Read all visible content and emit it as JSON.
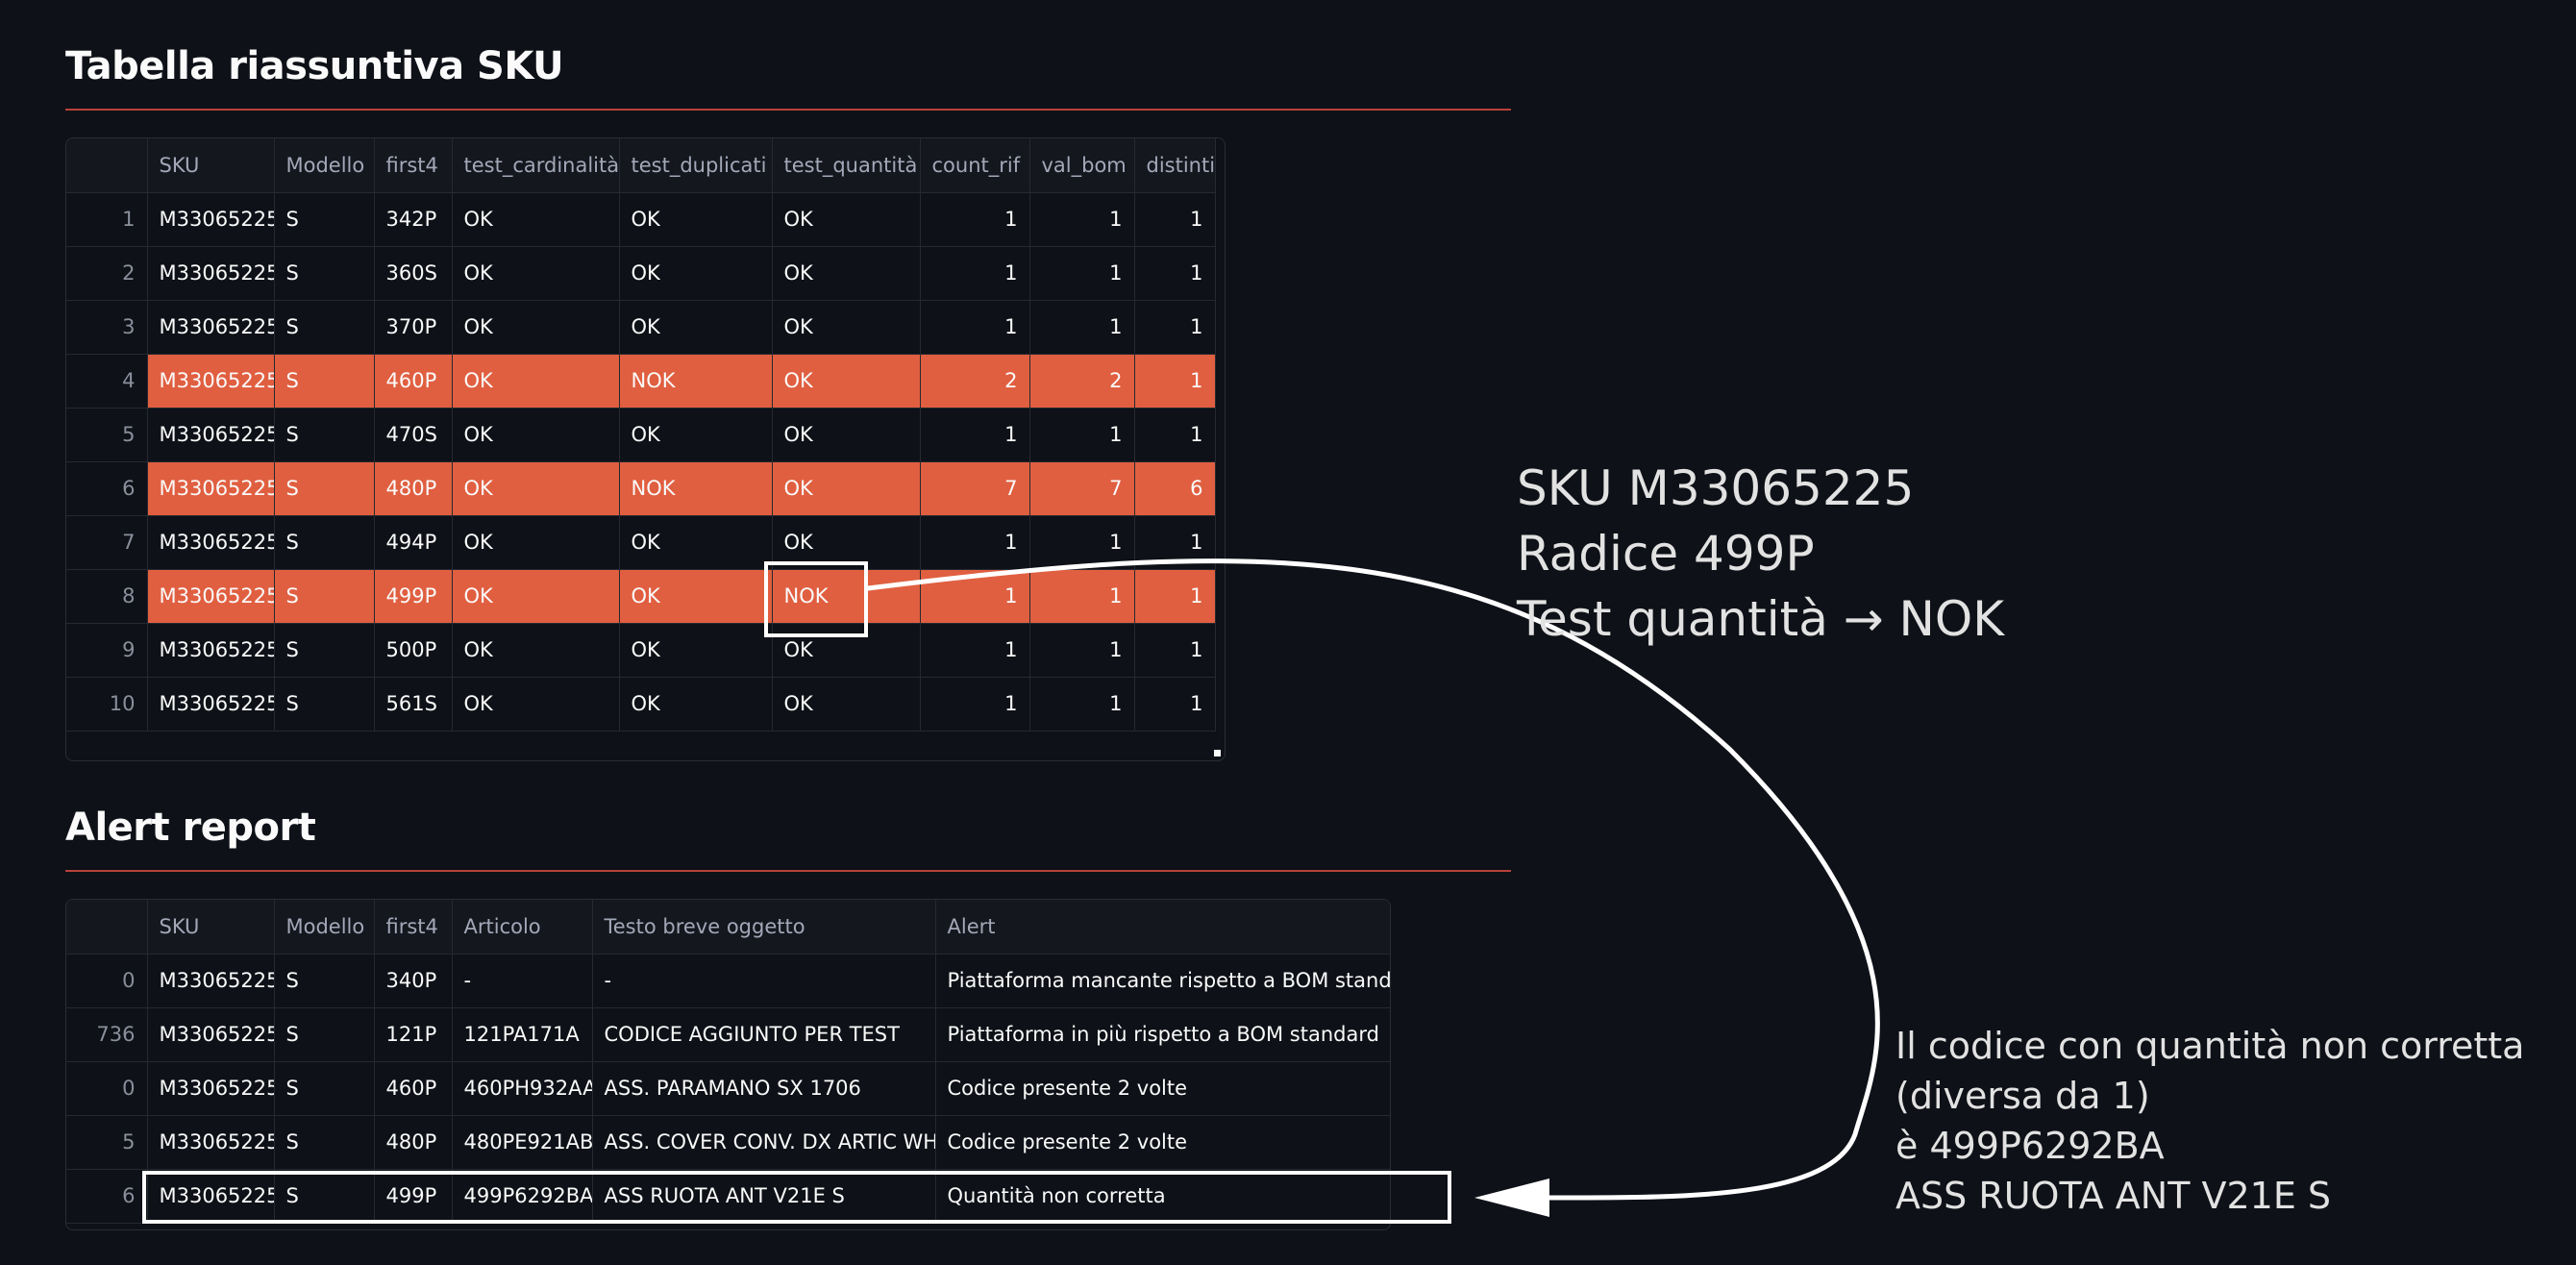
{
  "summary": {
    "title": "Tabella riassuntiva SKU",
    "columns": [
      "",
      "SKU",
      "Modello",
      "first4",
      "test_cardinalità",
      "test_duplicati",
      "test_quantità",
      "count_rif",
      "val_bom",
      "distinti"
    ],
    "rows": [
      {
        "index": "1",
        "sku": "M33065225",
        "modello": "S",
        "first4": "342P",
        "card": "OK",
        "dup": "OK",
        "qty": "OK",
        "count_rif": "1",
        "val_bom": "1",
        "distinti": "1",
        "highlight": false
      },
      {
        "index": "2",
        "sku": "M33065225",
        "modello": "S",
        "first4": "360S",
        "card": "OK",
        "dup": "OK",
        "qty": "OK",
        "count_rif": "1",
        "val_bom": "1",
        "distinti": "1",
        "highlight": false
      },
      {
        "index": "3",
        "sku": "M33065225",
        "modello": "S",
        "first4": "370P",
        "card": "OK",
        "dup": "OK",
        "qty": "OK",
        "count_rif": "1",
        "val_bom": "1",
        "distinti": "1",
        "highlight": false
      },
      {
        "index": "4",
        "sku": "M33065225",
        "modello": "S",
        "first4": "460P",
        "card": "OK",
        "dup": "NOK",
        "qty": "OK",
        "count_rif": "2",
        "val_bom": "2",
        "distinti": "1",
        "highlight": true
      },
      {
        "index": "5",
        "sku": "M33065225",
        "modello": "S",
        "first4": "470S",
        "card": "OK",
        "dup": "OK",
        "qty": "OK",
        "count_rif": "1",
        "val_bom": "1",
        "distinti": "1",
        "highlight": false
      },
      {
        "index": "6",
        "sku": "M33065225",
        "modello": "S",
        "first4": "480P",
        "card": "OK",
        "dup": "NOK",
        "qty": "OK",
        "count_rif": "7",
        "val_bom": "7",
        "distinti": "6",
        "highlight": true
      },
      {
        "index": "7",
        "sku": "M33065225",
        "modello": "S",
        "first4": "494P",
        "card": "OK",
        "dup": "OK",
        "qty": "OK",
        "count_rif": "1",
        "val_bom": "1",
        "distinti": "1",
        "highlight": false
      },
      {
        "index": "8",
        "sku": "M33065225",
        "modello": "S",
        "first4": "499P",
        "card": "OK",
        "dup": "OK",
        "qty": "NOK",
        "count_rif": "1",
        "val_bom": "1",
        "distinti": "1",
        "highlight": true
      },
      {
        "index": "9",
        "sku": "M33065225",
        "modello": "S",
        "first4": "500P",
        "card": "OK",
        "dup": "OK",
        "qty": "OK",
        "count_rif": "1",
        "val_bom": "1",
        "distinti": "1",
        "highlight": false
      },
      {
        "index": "10",
        "sku": "M33065225",
        "modello": "S",
        "first4": "561S",
        "card": "OK",
        "dup": "OK",
        "qty": "OK",
        "count_rif": "1",
        "val_bom": "1",
        "distinti": "1",
        "highlight": false
      }
    ]
  },
  "alerts": {
    "title": "Alert report",
    "columns": [
      "",
      "SKU",
      "Modello",
      "first4",
      "Articolo",
      "Testo breve oggetto",
      "Alert"
    ],
    "rows": [
      {
        "index": "0",
        "sku": "M33065225",
        "modello": "S",
        "first4": "340P",
        "articolo": "-",
        "testo": "-",
        "alert": "Piattaforma mancante rispetto a BOM standard"
      },
      {
        "index": "736",
        "sku": "M33065225",
        "modello": "S",
        "first4": "121P",
        "articolo": "121PA171A",
        "testo": "CODICE AGGIUNTO PER TEST",
        "alert": "Piattaforma in più rispetto a BOM standard"
      },
      {
        "index": "0",
        "sku": "M33065225",
        "modello": "S",
        "first4": "460P",
        "articolo": "460PH932AA",
        "testo": "ASS. PARAMANO SX 1706",
        "alert": "Codice presente 2 volte"
      },
      {
        "index": "5",
        "sku": "M33065225",
        "modello": "S",
        "first4": "480P",
        "articolo": "480PE921AB",
        "testo": "ASS. COVER CONV. DX ARTIC WHITE",
        "alert": "Codice presente 2 volte"
      },
      {
        "index": "6",
        "sku": "M33065225",
        "modello": "S",
        "first4": "499P",
        "articolo": "499P6292BA",
        "testo": "ASS RUOTA ANT V21E S",
        "alert": "Quantità non corretta"
      }
    ]
  },
  "annotations": {
    "callout_1": "SKU M33065225\nRadice 499P\nTest quantità → NOK",
    "callout_2": "Il codice con quantità non corretta\n(diversa da 1)\nè 499P6292BA\nASS RUOTA ANT V21E S"
  },
  "colors": {
    "background": "#0e1117",
    "highlight_row": "#e05f40",
    "divider": "#b8423a",
    "annotation_stroke": "#ffffff"
  }
}
